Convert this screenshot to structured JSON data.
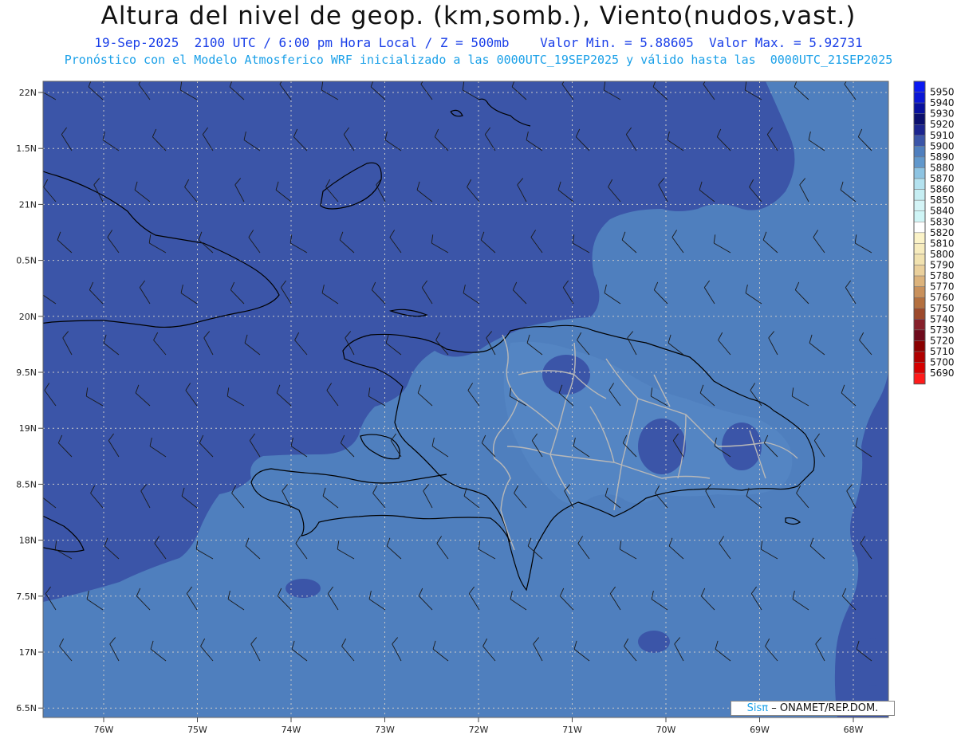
{
  "header": {
    "title": "Altura del nivel de geop. (km,somb.), Viento(nudos,vast.)",
    "subtitle": "19-Sep-2025  2100 UTC / 6:00 pm Hora Local / Z = 500mb    Valor Min. = 5.88605  Valor Max. = 5.92731",
    "subtitle2": "Pronóstico con el Modelo Atmosferico WRF inicializado a las 0000UTC_19SEP2025 y válido hasta las  0000UTC_21SEP2025"
  },
  "map": {
    "lat_labels": [
      "22N",
      "1.5N",
      "21N",
      "0.5N",
      "20N",
      "9.5N",
      "19N",
      "8.5N",
      "18N",
      "7.5N",
      "17N",
      "6.5N"
    ],
    "lon_labels": [
      "76W",
      "75W",
      "74W",
      "73W",
      "72W",
      "71W",
      "70W",
      "69W",
      "68W"
    ],
    "fill_dark": "#3b55a8",
    "fill_light": "#4f7fbe",
    "fill_medium": "#5a8bc6",
    "coast_color": "#000000",
    "border_color": "#b8b8b8"
  },
  "colorbar": {
    "levels": [
      {
        "label": "5950",
        "color": "#0a19f2"
      },
      {
        "label": "5940",
        "color": "#0a16d6"
      },
      {
        "label": "5930",
        "color": "#08109e"
      },
      {
        "label": "5920",
        "color": "#0b0f6e"
      },
      {
        "label": "5910",
        "color": "#1c258f"
      },
      {
        "label": "5900",
        "color": "#3b55a8"
      },
      {
        "label": "5890",
        "color": "#4f7fbe"
      },
      {
        "label": "5880",
        "color": "#6198cc"
      },
      {
        "label": "5870",
        "color": "#8ec4e2"
      },
      {
        "label": "5860",
        "color": "#b4e2ef"
      },
      {
        "label": "5850",
        "color": "#c6eef3"
      },
      {
        "label": "5840",
        "color": "#d4f4f6"
      },
      {
        "label": "5830",
        "color": "#cff5f6"
      },
      {
        "label": "5820",
        "color": "#ffffff"
      },
      {
        "label": "5810",
        "color": "#fbf3c8"
      },
      {
        "label": "5800",
        "color": "#f7ecbe"
      },
      {
        "label": "5790",
        "color": "#f1e2b0"
      },
      {
        "label": "5780",
        "color": "#ead09c"
      },
      {
        "label": "5770",
        "color": "#dcb37c"
      },
      {
        "label": "5760",
        "color": "#c9915c"
      },
      {
        "label": "5750",
        "color": "#b4703f"
      },
      {
        "label": "5740",
        "color": "#9d4a2c"
      },
      {
        "label": "5730",
        "color": "#86202a"
      },
      {
        "label": "5720",
        "color": "#6e0a1c"
      },
      {
        "label": "5710",
        "color": "#8a0000"
      },
      {
        "label": "5700",
        "color": "#b00000"
      },
      {
        "label": "5690",
        "color": "#d60000"
      },
      {
        "label": "",
        "color": "#ff1a1a"
      }
    ]
  },
  "credit": {
    "brand": "Sisπ",
    "text": "– ONAMET/REP.DOM."
  }
}
